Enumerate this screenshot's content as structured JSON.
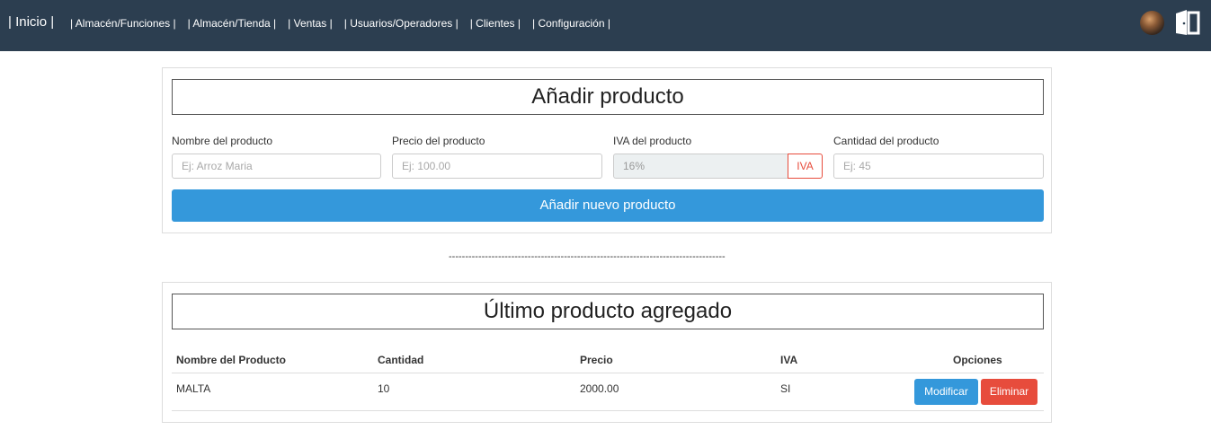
{
  "nav": {
    "brand": "| Inicio |",
    "links": [
      "| Almacén/Funciones |",
      "| Almacén/Tienda |",
      "| Ventas |",
      "| Usuarios/Operadores |",
      "| Clientes |",
      "| Configuración |"
    ]
  },
  "add_product": {
    "title": "Añadir producto",
    "name_label": "Nombre del producto",
    "name_placeholder": "Ej: Arroz Maria",
    "price_label": "Precio del producto",
    "price_placeholder": "Ej: 100.00",
    "iva_label": "IVA del producto",
    "iva_value": "16%",
    "iva_addon": "IVA",
    "qty_label": "Cantidad del producto",
    "qty_placeholder": "Ej: 45",
    "submit_label": "Añadir nuevo producto"
  },
  "divider": "------------------------------------------------------------------------------------",
  "last_product": {
    "title": "Último producto agregado",
    "headers": [
      "Nombre del Producto",
      "Cantidad",
      "Precio",
      "IVA",
      "Opciones"
    ],
    "row": {
      "name": "MALTA",
      "qty": "10",
      "price": "2000.00",
      "iva": "SI"
    },
    "edit_label": "Modificar",
    "delete_label": "Eliminar"
  },
  "colors": {
    "navbar": "#2c3e50",
    "primary": "#3498db",
    "danger": "#e74c3c"
  }
}
